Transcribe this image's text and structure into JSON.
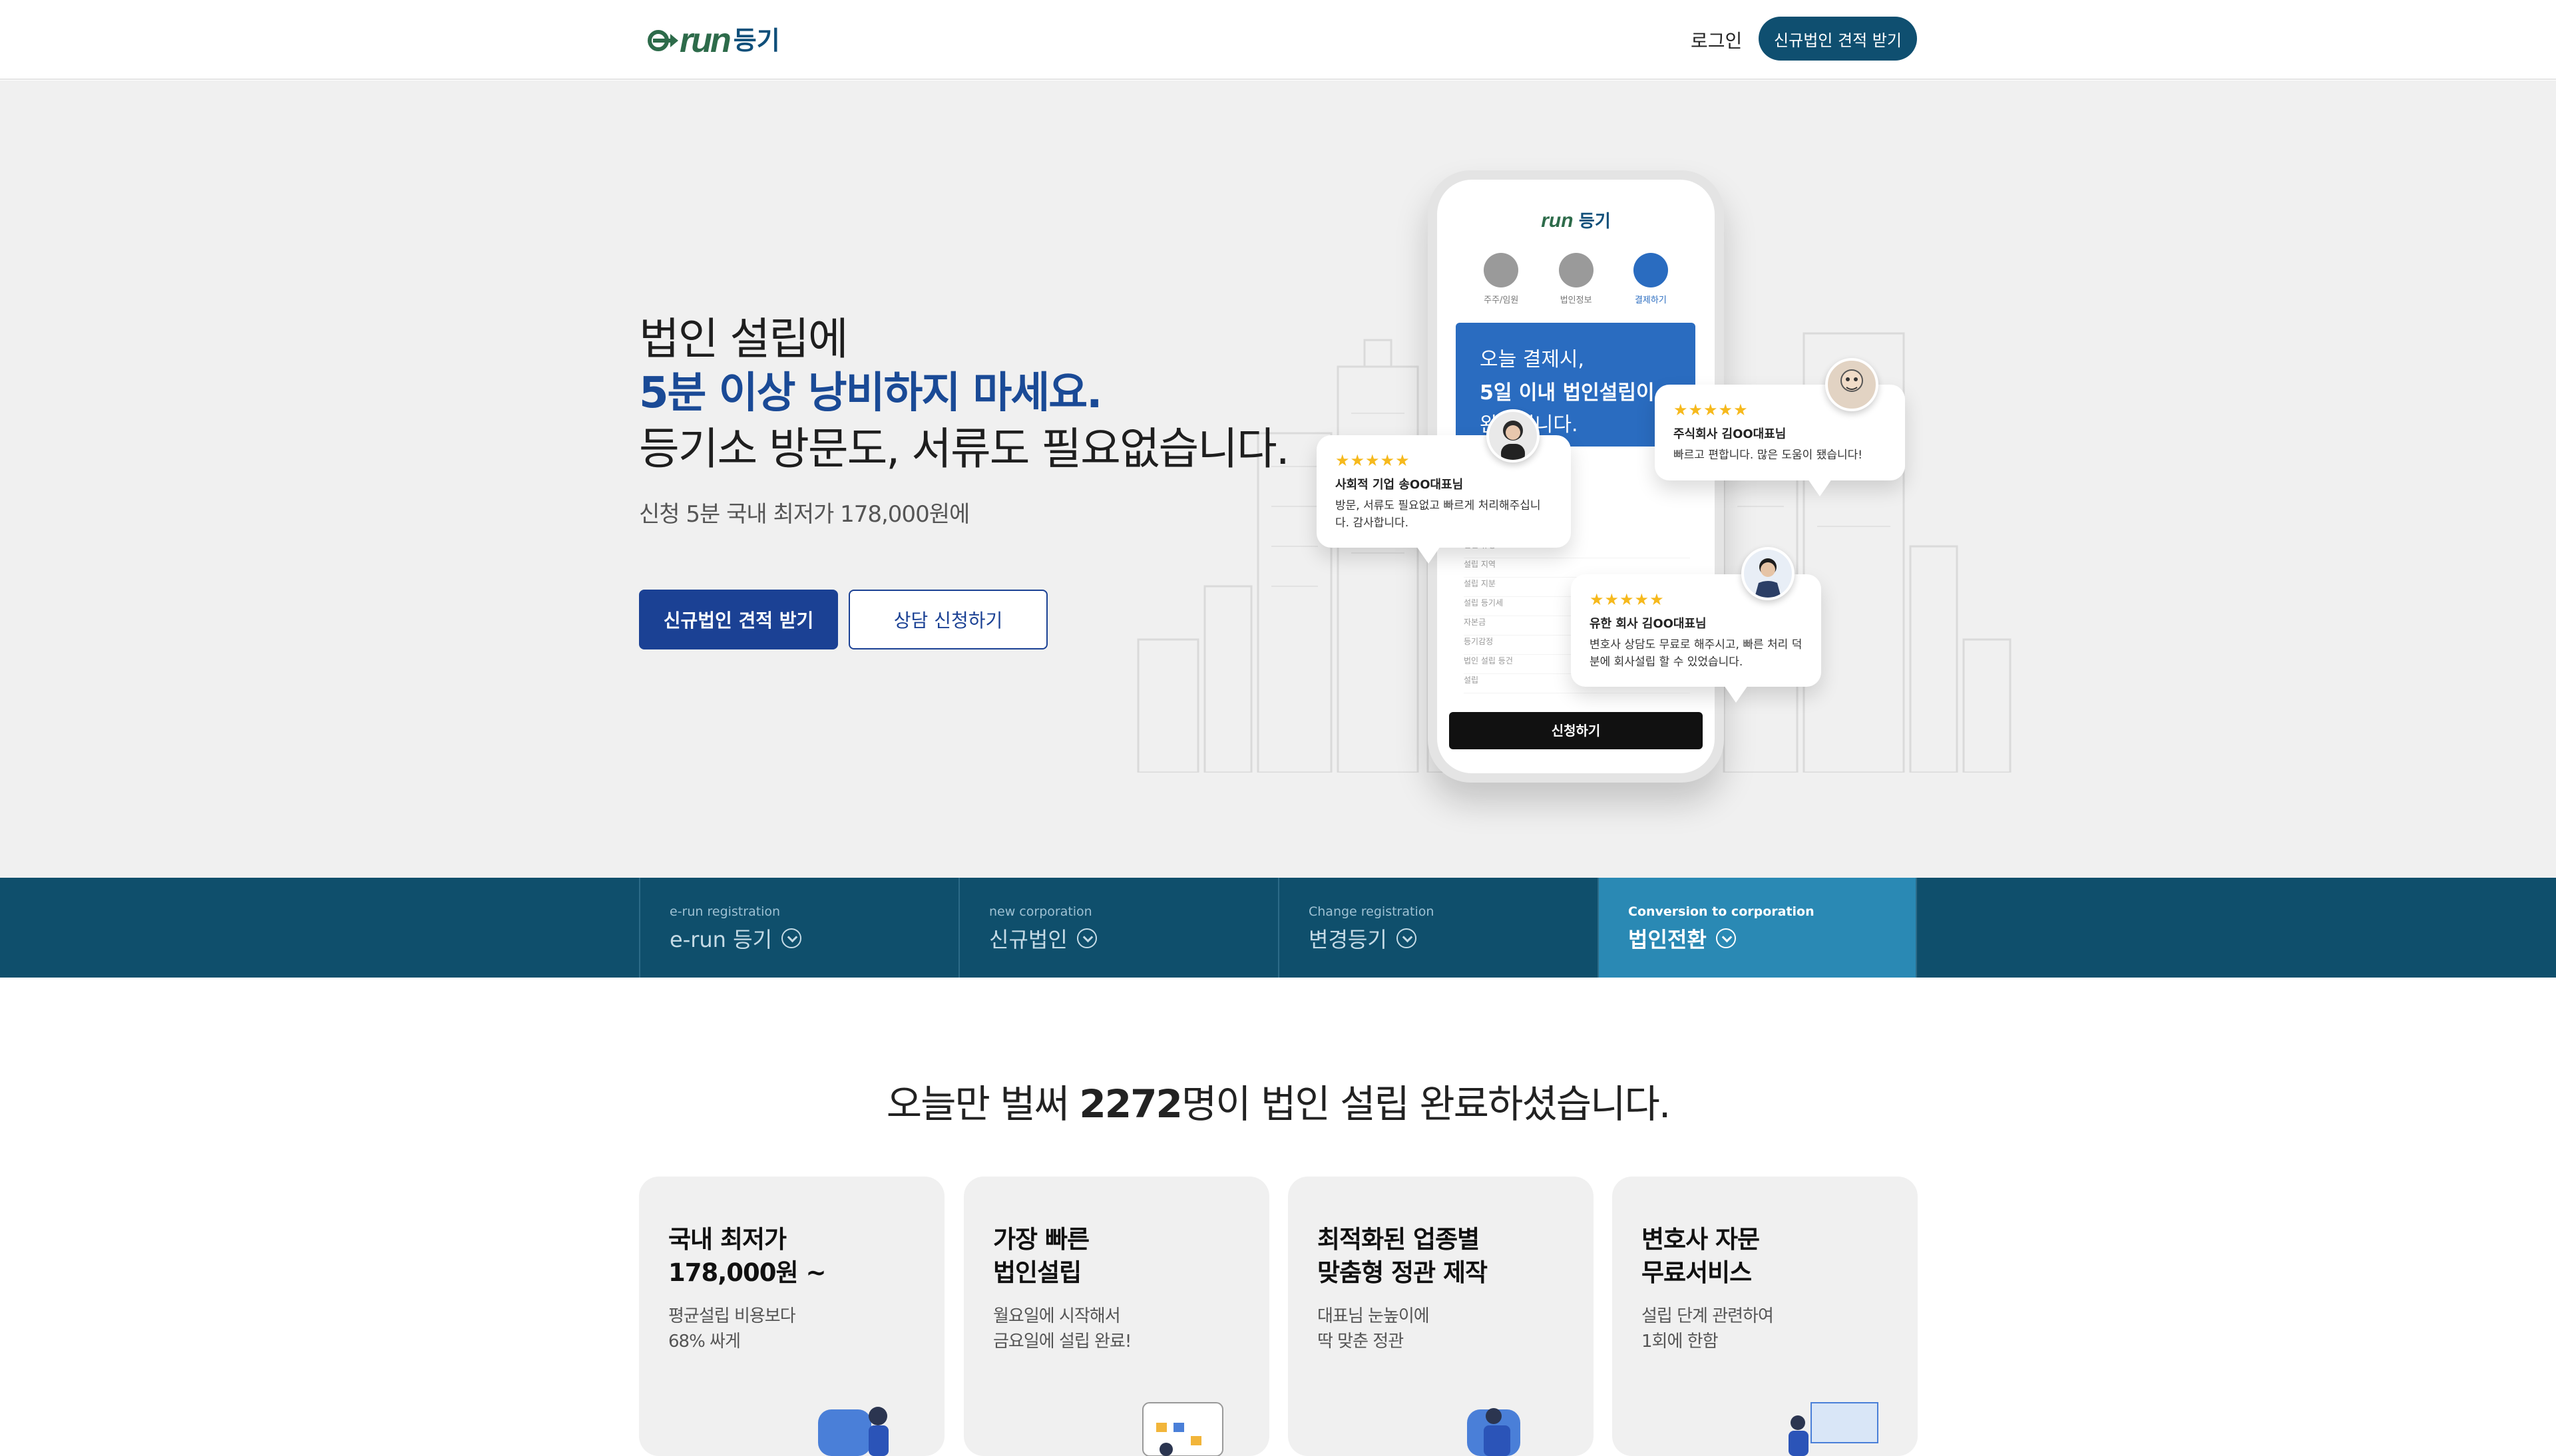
{
  "header": {
    "logo_e": "e",
    "logo_run": "run",
    "logo_ko": "등기",
    "login": "로그인",
    "cta": "신규법인 견적 받기"
  },
  "hero": {
    "line1": "법인 설립에",
    "line2": "5분 이상 낭비하지 마세요.",
    "line3": "등기소 방문도, 서류도 필요없습니다.",
    "subtitle": "신청 5분 국내 최저가 178,000원에",
    "primary_button": "신규법인 견적 받기",
    "secondary_button": "상담 신청하기"
  },
  "phone": {
    "logo_run": "run",
    "logo_ko": "등기",
    "steps": [
      {
        "label": "주주/임원"
      },
      {
        "label": "법인정보"
      },
      {
        "label": "결제하기"
      }
    ],
    "banner_l1": "오늘 결제시,",
    "banner_l2": "5일 이내 법인설립이",
    "banner_l3": "완료됩니다.",
    "list": [
      "법인 유형",
      "설립 지역",
      "설립 지분",
      "설립 등기세",
      "자본금",
      "등기감정",
      "법인 설립 등건",
      "설립",
      "설립 대신 주주"
    ],
    "cta": "신청하기"
  },
  "reviews": [
    {
      "stars": "★★★★★",
      "name": "사회적 기업 송OO대표님",
      "text": "방문, 서류도 필요없고 빠르게 처리해주십니다. 감사합니다."
    },
    {
      "stars": "★★★★★",
      "name": "주식회사 김OO대표님",
      "text": "빠르고 편합니다. 많은 도움이 됐습니다!"
    },
    {
      "stars": "★★★★★",
      "name": "유한 회사 김OO대표님",
      "text": "변호사 상담도 무료로 해주시고, 빠른 처리 덕분에 회사설립 할 수 있었습니다."
    }
  ],
  "tabs": [
    {
      "en": "e-run registration",
      "ko": "e-run 등기",
      "active": false
    },
    {
      "en": "new corporation",
      "ko": "신규법인",
      "active": false
    },
    {
      "en": "Change registration",
      "ko": "변경등기",
      "active": false
    },
    {
      "en": "Conversion to corporation",
      "ko": "법인전환",
      "active": true
    }
  ],
  "stats": {
    "prefix": "오늘만 벌써 ",
    "count": "2272",
    "suffix": "명이 법인 설립 완료하셨습니다."
  },
  "cards": [
    {
      "title_l1": "국내 최저가",
      "title_l2": "178,000원 ~",
      "desc_l1": "평균설립 비용보다",
      "desc_l2": "68% 싸게"
    },
    {
      "title_l1": "가장 빠른",
      "title_l2": "법인설립",
      "desc_l1": "월요일에 시작해서",
      "desc_l2": "금요일에 설립 완료!"
    },
    {
      "title_l1": "최적화된 업종별",
      "title_l2": "맞춤형 정관 제작",
      "desc_l1": "대표님 눈높이에",
      "desc_l2": "딱 맞춘 정관"
    },
    {
      "title_l1": "변호사 자문",
      "title_l2": "무료서비스",
      "desc_l1": "설립 단계 관련하여",
      "desc_l2": "1회에 한함"
    }
  ],
  "colors": {
    "brand_navy": "#1b4194",
    "header_cta": "#0f4f70",
    "tabbar_bg": "#0f4f6c",
    "tab_active": "#2a89b4",
    "logo_green": "#2d6b4a"
  }
}
